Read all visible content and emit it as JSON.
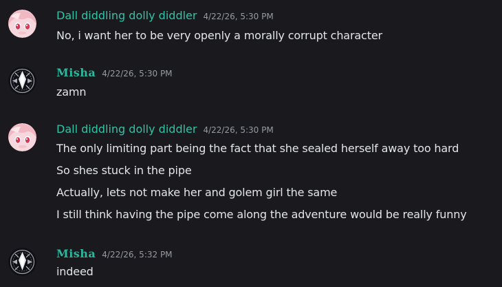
{
  "messages": [
    {
      "author": "Dall diddling dolly diddler",
      "timestamp": "4/22/26, 5:30 PM",
      "avatar_icon": "pink-anime-girl-avatar",
      "lines": [
        "No, i want her to be very openly a morally corrupt character"
      ]
    },
    {
      "author": "Misha",
      "timestamp": "4/22/26, 5:30 PM",
      "avatar_icon": "silver-emblem-avatar",
      "lines": [
        "zamn"
      ]
    },
    {
      "author": "Dall diddling dolly diddler",
      "timestamp": "4/22/26, 5:30 PM",
      "avatar_icon": "pink-anime-girl-avatar",
      "lines": [
        "The only limiting part being the fact that she sealed herself away too hard",
        "So shes stuck in the pipe",
        "Actually, lets not make her and golem girl the same",
        "I still think having the pipe come along the adventure would be really funny"
      ]
    },
    {
      "author": "Misha",
      "timestamp": "4/22/26, 5:32 PM",
      "avatar_icon": "silver-emblem-avatar",
      "lines": [
        "indeed"
      ]
    }
  ],
  "colors": {
    "background": "#1a1a1e",
    "author_name": "#2ec4a6",
    "timestamp": "#959aa3",
    "message_text": "#e3e5e8"
  }
}
